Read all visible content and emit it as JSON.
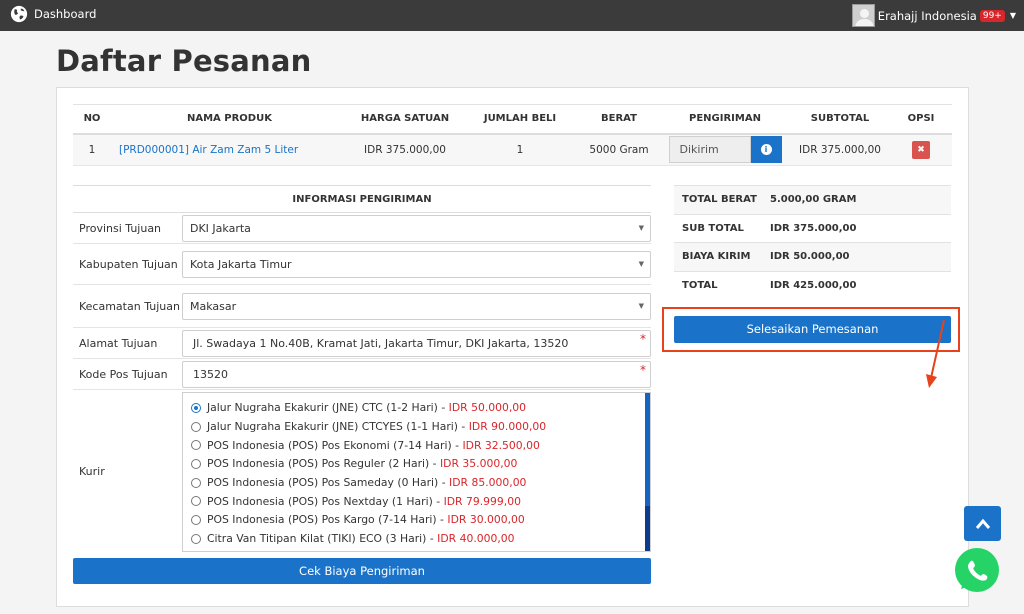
{
  "topbar": {
    "brand_label": "Dashboard",
    "user_name": "Erahajj Indonesia",
    "notif_badge": "99+"
  },
  "page_title": "Daftar Pesanan",
  "order_table": {
    "headers": [
      "NO",
      "NAMA PRODUK",
      "HARGA SATUAN",
      "JUMLAH BELI",
      "BERAT",
      "PENGIRIMAN",
      "SUBTOTAL",
      "OPSI"
    ],
    "rows": [
      {
        "no": "1",
        "product": "[PRD000001] Air Zam Zam 5 Liter",
        "price": "IDR 375.000,00",
        "qty": "1",
        "weight": "5000 Gram",
        "shipping": "Dikirim",
        "subtotal": "IDR 375.000,00"
      }
    ]
  },
  "shipping_form": {
    "title": "INFORMASI PENGIRIMAN",
    "province_label": "Provinsi Tujuan",
    "province_value": "DKI Jakarta",
    "city_label": "Kabupaten Tujuan",
    "city_value": "Kota Jakarta Timur",
    "district_label": "Kecamatan Tujuan",
    "district_value": "Makasar",
    "address_label": "Alamat Tujuan",
    "address_value": "Jl. Swadaya 1 No.40B, Kramat Jati, Jakarta Timur, DKI Jakarta, 13520",
    "postcode_label": "Kode Pos Tujuan",
    "postcode_value": "13520",
    "courier_label": "Kurir",
    "couriers": [
      {
        "name": "Jalur Nugraha Ekakurir (JNE) CTC (1-2 Hari) -",
        "price": "IDR 50.000,00",
        "selected": true
      },
      {
        "name": "Jalur Nugraha Ekakurir (JNE) CTCYES (1-1 Hari) -",
        "price": "IDR 90.000,00",
        "selected": false
      },
      {
        "name": "POS Indonesia (POS) Pos Ekonomi (7-14 Hari) -",
        "price": "IDR 32.500,00",
        "selected": false
      },
      {
        "name": "POS Indonesia (POS) Pos Reguler (2 Hari) -",
        "price": "IDR 35.000,00",
        "selected": false
      },
      {
        "name": "POS Indonesia (POS) Pos Sameday (0 Hari) -",
        "price": "IDR 85.000,00",
        "selected": false
      },
      {
        "name": "POS Indonesia (POS) Pos Nextday (1 Hari) -",
        "price": "IDR 79.999,00",
        "selected": false
      },
      {
        "name": "POS Indonesia (POS) Pos Kargo (7-14 Hari) -",
        "price": "IDR 30.000,00",
        "selected": false
      },
      {
        "name": "Citra Van Titipan Kilat (TIKI) ECO (3 Hari) -",
        "price": "IDR 40.000,00",
        "selected": false
      }
    ],
    "check_button": "Cek Biaya Pengiriman"
  },
  "totals": {
    "weight_label": "TOTAL BERAT",
    "weight_value": "5.000,00 GRAM",
    "subtotal_label": "SUB TOTAL",
    "subtotal_value": "IDR 375.000,00",
    "shipping_label": "BIAYA KIRIM",
    "shipping_value": "IDR 50.000,00",
    "total_label": "TOTAL",
    "total_value": "IDR 425.000,00"
  },
  "finish_button": "Selesaikan Pemesanan",
  "colors": {
    "primary": "#1a73c8",
    "danger": "#d9534f",
    "price_red": "#d9262b",
    "highlight": "#e8421c",
    "topbar": "#3b3b3b",
    "whatsapp": "#25d366"
  }
}
